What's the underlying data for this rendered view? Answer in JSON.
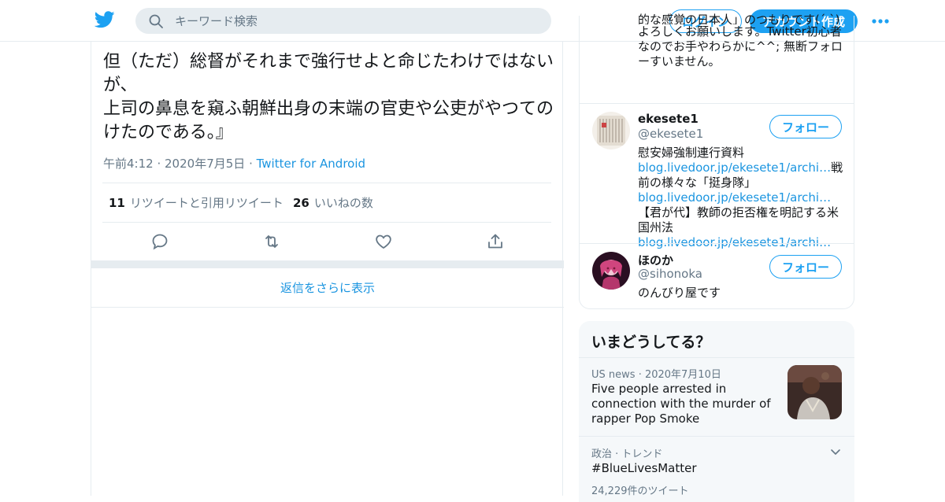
{
  "colors": {
    "accent": "#1da1f2",
    "link": "#1b95e0",
    "text": "#14171a",
    "muted": "#657786",
    "border": "#e6ecf0"
  },
  "header": {
    "logo_icon": "twitter-bird-icon",
    "search_placeholder": "キーワード検索",
    "login_label": "ログイン",
    "signup_label": "アカウント作成",
    "more_icon": "more-dots-icon"
  },
  "tweet": {
    "text": "但（ただ）総督がそれまで強行せよと命じたわけではないが、\n上司の鼻息を窺ふ朝鮮出身の末端の官吏や公吏がやつてのけたのである。』",
    "time": "午前4:12",
    "date": "2020年7月5日",
    "source": "Twitter for Android",
    "retweet_count": "11",
    "retweet_label": "リツイートと引用リツイート",
    "like_count": "26",
    "like_label": "いいねの数",
    "more_replies_label": "返信をさらに表示"
  },
  "who_to_follow": {
    "top_bio_partial": "的な感覚の日本人」のつもりです(´ `)",
    "top_bio_rest": "よろしくお願いします。Twitter初心者なのでお手やわらかに^^; 無断フォローすいません。",
    "users": [
      {
        "name": "ekesete1",
        "handle": "@ekesete1",
        "follow_label": "フォロー",
        "bio_1": "慰安婦強制連行資料",
        "link_1": "blog.livedoor.jp/ekesete1/archi…",
        "bio_2": "戦前の様々な「挺身隊」",
        "link_2": "blog.livedoor.jp/ekesete1/archi…",
        "bio_3": "【君が代】教師の拒否権を明記する米国州法",
        "link_3": "blog.livedoor.jp/ekesete1/archi…"
      },
      {
        "name": "ほのか",
        "handle": "@sihonoka",
        "follow_label": "フォロー",
        "bio": "のんびり屋です"
      }
    ]
  },
  "trends": {
    "heading": "いまどうしてる？",
    "news": {
      "source": "US news",
      "date": "2020年7月10日",
      "title": "Five people arrested in connection with the murder of rapper Pop Smoke"
    },
    "trend": {
      "category": "政治 · トレンド",
      "name": "#BlueLivesMatter",
      "count": "24,229件のツイート"
    }
  }
}
